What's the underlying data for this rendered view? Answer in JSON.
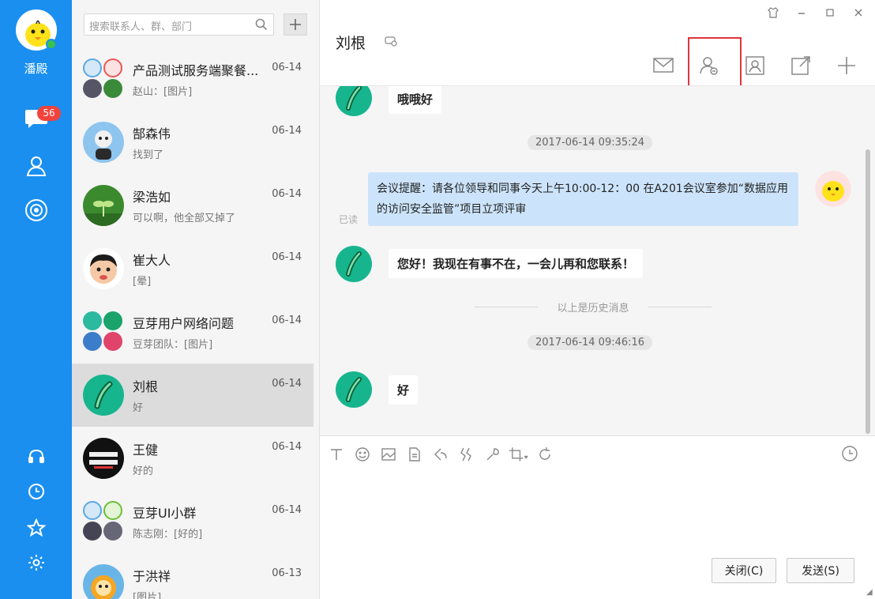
{
  "sidebar": {
    "self_name": "潘殿",
    "unread_badge": "56",
    "nav": [
      {
        "icon": "chat-bubble-icon"
      },
      {
        "icon": "contacts-icon"
      },
      {
        "icon": "target-icon"
      },
      {
        "icon": "headset-icon"
      },
      {
        "icon": "clock-icon"
      },
      {
        "icon": "star-icon"
      },
      {
        "icon": "gear-icon"
      }
    ],
    "accent_color": "#1a8ff0"
  },
  "search": {
    "placeholder": "搜索联系人、群、部门"
  },
  "conversations": [
    {
      "name": "产品测试服务端聚餐...",
      "date": "06-14",
      "preview": "赵山：[图片]",
      "group": true
    },
    {
      "name": "郜森伟",
      "date": "06-14",
      "preview": "找到了"
    },
    {
      "name": "梁浩如",
      "date": "06-14",
      "preview": "可以啊，他全部又掉了"
    },
    {
      "name": "崔大人",
      "date": "06-14",
      "preview": "[晕]"
    },
    {
      "name": "豆芽用户网络问题",
      "date": "06-14",
      "preview": "豆芽团队：[图片]",
      "group": true
    },
    {
      "name": "刘根",
      "date": "06-14",
      "preview": "好",
      "selected": true
    },
    {
      "name": "王健",
      "date": "06-14",
      "preview": "好的"
    },
    {
      "name": "豆芽UI小群",
      "date": "06-14",
      "preview": "陈志刚：[好的]",
      "group": true
    },
    {
      "name": "于洪祥",
      "date": "06-13",
      "preview": "[图片]"
    }
  ],
  "chat": {
    "title": "刘根",
    "toolbar": [
      "mail-icon",
      "contact-card-icon",
      "profile-icon",
      "share-window-icon",
      "plus-icon"
    ],
    "messages": [
      {
        "type": "received",
        "text": "哦哦好"
      },
      {
        "type": "time",
        "text": "2017-06-14 09:35:24"
      },
      {
        "type": "sent",
        "text": "会议提醒：请各位领导和同事今天上午10:00-12：00 在A201会议室参加“数据应用的访问安全监管”项目立项评审",
        "status": "已读"
      },
      {
        "type": "received",
        "text": "您好！我现在有事不在，一会儿再和您联系！"
      },
      {
        "type": "divider",
        "text": "以上是历史消息"
      },
      {
        "type": "time",
        "text": "2017-06-14 09:46:16"
      },
      {
        "type": "received",
        "text": "好"
      }
    ]
  },
  "compose": {
    "tools": [
      "text-format-icon",
      "emoji-icon",
      "image-icon",
      "file-icon",
      "screenshot-icon",
      "shake-icon",
      "wrench-icon",
      "crop-icon",
      "refresh-icon"
    ],
    "close_label": "关闭(C)",
    "send_label": "发送(S)"
  }
}
